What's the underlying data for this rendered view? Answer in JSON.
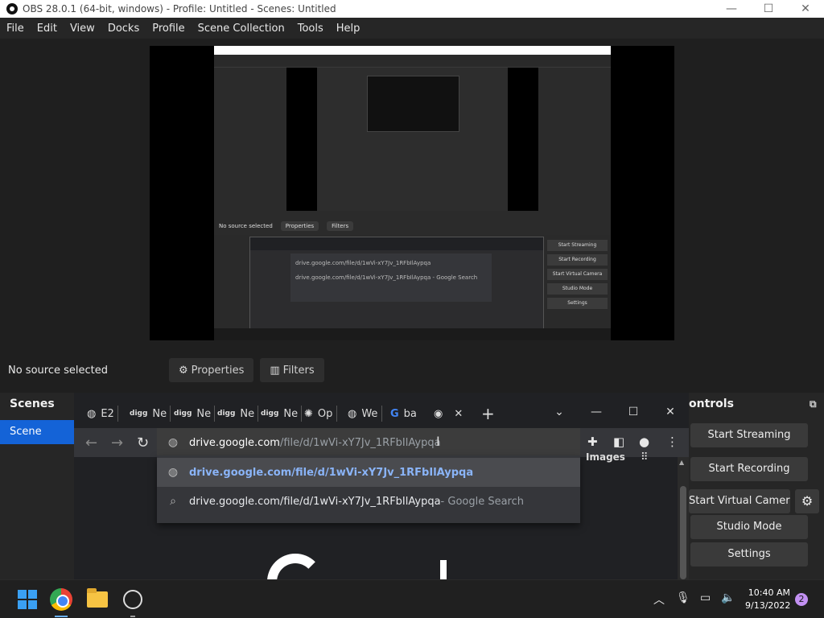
{
  "window": {
    "title": "OBS 28.0.1 (64-bit, windows) - Profile: Untitled - Scenes: Untitled",
    "minimize": "—",
    "maximize": "☐",
    "close": "✕"
  },
  "menu": [
    "File",
    "Edit",
    "View",
    "Docks",
    "Profile",
    "Scene Collection",
    "Tools",
    "Help"
  ],
  "preview_nested": {
    "no_source": "No source selected",
    "properties": "Properties",
    "filters": "Filters",
    "scenes": "Scenes",
    "scene": "Scene",
    "controls": "Controls",
    "start_streaming": "Start Streaming",
    "start_recording": "Start Recording",
    "start_virtual_camera": "Start Virtual Camera",
    "studio_mode": "Studio Mode",
    "settings": "Settings",
    "url": "drive.google.com/file/d/1wVi-xY7Jv_1RFbIlAypqa",
    "suggestion_2": "drive.google.com/file/d/1wVi-xY7Jv_1RFbIlAypqa - Google Search",
    "images": "Images",
    "time": "10:40 AM",
    "date": "9/13/2022"
  },
  "sourcebar": {
    "no_source": "No source selected",
    "properties": "Properties",
    "filters": "Filters"
  },
  "scenes_dock": {
    "title": "Scenes",
    "items": [
      "Scene"
    ]
  },
  "controls_dock": {
    "title": "ontrols",
    "start_streaming": "Start Streaming",
    "start_recording": "Start Recording",
    "start_virtual_camera": "Start Virtual Camera",
    "studio_mode": "Studio Mode",
    "settings": "Settings"
  },
  "chrome": {
    "tabs": [
      {
        "icon": "globe-icon",
        "label": "E2"
      },
      {
        "icon": "digg-icon",
        "label": "Ne"
      },
      {
        "icon": "digg-icon",
        "label": "Ne"
      },
      {
        "icon": "digg-icon",
        "label": "Ne"
      },
      {
        "icon": "digg-icon",
        "label": "Ne"
      },
      {
        "icon": "openai-icon",
        "label": "Op"
      },
      {
        "icon": "globe-icon",
        "label": "We"
      },
      {
        "icon": "google-icon",
        "label": "ba"
      }
    ],
    "favicon_digg": "digg",
    "omnibox": {
      "host": "drive.google.com",
      "path": "/file/d/1wVi-xY7Jv_1RFbIlAypqa"
    },
    "suggestions": [
      {
        "icon": "globe-icon",
        "text": "drive.google.com/file/d/1wVi-xY7Jv_1RFbIlAypqa",
        "suffix": ""
      },
      {
        "icon": "search-icon",
        "text": "drive.google.com/file/d/1wVi-xY7Jv_1RFbIlAypqa",
        "suffix": " - Google Search"
      }
    ],
    "images_label": "Images"
  },
  "taskbar": {
    "time": "10:40 AM",
    "date": "9/13/2022",
    "notification_count": "2"
  },
  "colors": {
    "accent": "#1463d7",
    "link": "#8ab4f8"
  }
}
